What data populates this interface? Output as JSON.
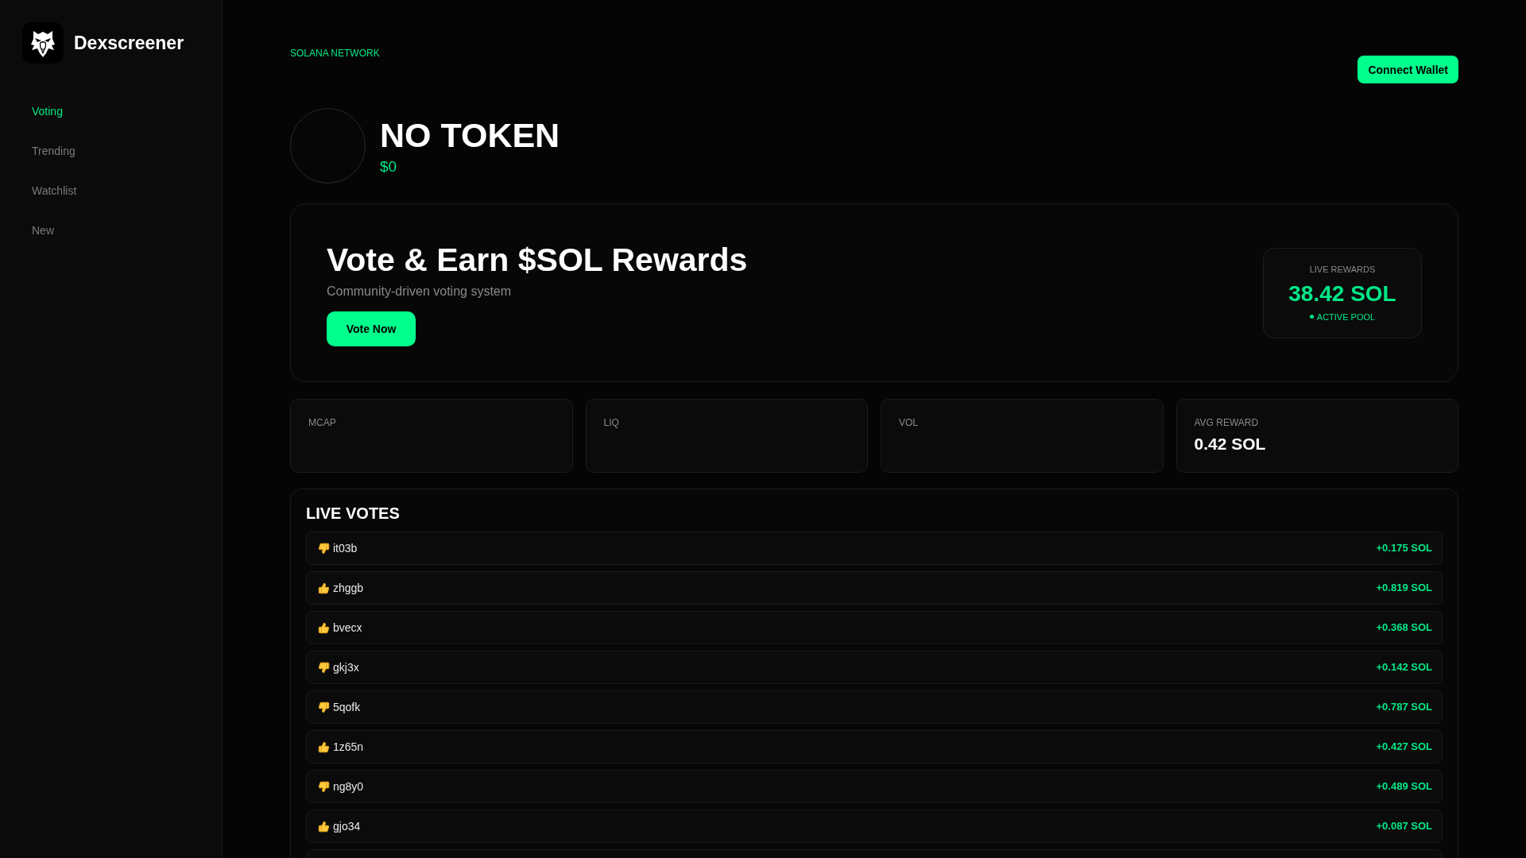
{
  "sidebar": {
    "brand": "Dexscreener",
    "items": [
      {
        "label": "Voting",
        "selected": true
      },
      {
        "label": "Trending",
        "selected": false
      },
      {
        "label": "Watchlist",
        "selected": false
      },
      {
        "label": "New",
        "selected": false
      }
    ]
  },
  "header": {
    "network": "SOLANA NETWORK",
    "connect_button": "Connect Wallet"
  },
  "token": {
    "name": "NO TOKEN",
    "price": "$0"
  },
  "hero": {
    "title": "Vote & Earn $SOL Rewards",
    "subtitle": "Community-driven voting system",
    "button": "Vote Now",
    "rewards": {
      "label": "LIVE REWARDS",
      "value": "38.42 SOL",
      "status": "ACTIVE POOL"
    }
  },
  "stats": [
    {
      "label": "MCAP"
    },
    {
      "label": "LIQ"
    },
    {
      "label": "VOL"
    },
    {
      "label": "AVG REWARD",
      "value": "0.42 SOL"
    }
  ],
  "live_votes": {
    "title": "LIVE VOTES",
    "votes": [
      {
        "kind": "down",
        "user": "it03b",
        "amount": "+0.175 SOL"
      },
      {
        "kind": "up",
        "user": "zhggb",
        "amount": "+0.819 SOL"
      },
      {
        "kind": "up",
        "user": "bvecx",
        "amount": "+0.368 SOL"
      },
      {
        "kind": "down",
        "user": "gkj3x",
        "amount": "+0.142 SOL"
      },
      {
        "kind": "down",
        "user": "5qofk",
        "amount": "+0.787 SOL"
      },
      {
        "kind": "up",
        "user": "1z65n",
        "amount": "+0.427 SOL"
      },
      {
        "kind": "down",
        "user": "ng8y0",
        "amount": "+0.489 SOL"
      },
      {
        "kind": "up",
        "user": "gjo34",
        "amount": "+0.087 SOL"
      }
    ]
  }
}
